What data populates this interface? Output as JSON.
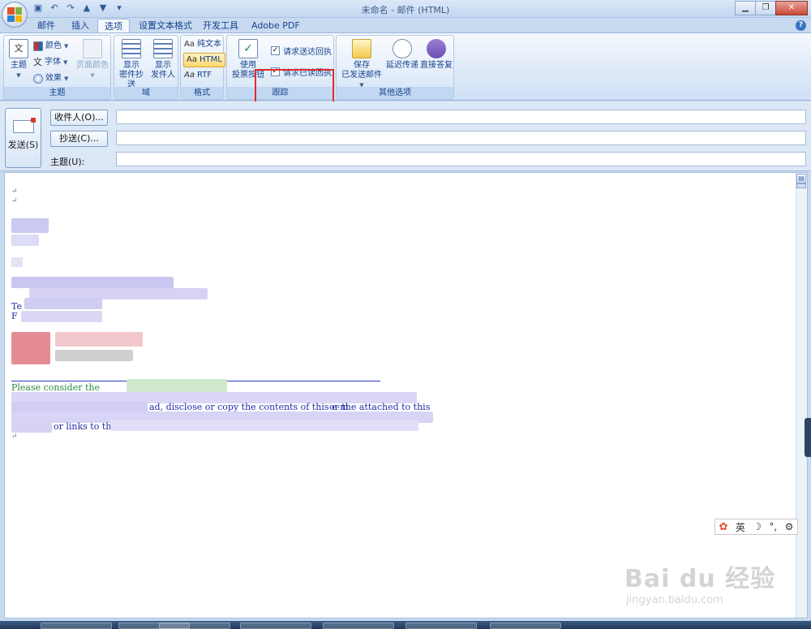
{
  "window": {
    "title": "未命名 - 邮件 (HTML)"
  },
  "tabs": [
    {
      "label": "邮件"
    },
    {
      "label": "插入"
    },
    {
      "label": "选项"
    },
    {
      "label": "设置文本格式"
    },
    {
      "label": "开发工具"
    },
    {
      "label": "Adobe PDF"
    }
  ],
  "ribbon": {
    "theme_group": {
      "label": "主题",
      "theme_btn": "主题",
      "colors": "颜色",
      "fonts": "字体",
      "effects": "效果",
      "page_color": "页面颜色"
    },
    "fields_group": {
      "label": "域",
      "show_bcc_line1": "显示",
      "show_bcc_line2": "密件抄送",
      "show_from_line1": "显示",
      "show_from_line2": "发件人"
    },
    "format_group": {
      "label": "格式",
      "plain": "纯文本",
      "html": "HTML",
      "rtf": "RTF"
    },
    "tracking_group": {
      "label": "跟踪",
      "voting_line1": "使用",
      "voting_line2": "投票按钮",
      "delivery_receipt": "请求送达回执",
      "read_receipt": "请求已读回执"
    },
    "more_group": {
      "label": "其他选项",
      "save_sent_line1": "保存",
      "save_sent_line2": "已发送邮件",
      "delay_delivery": "延迟传递",
      "direct_replies": "直接答复"
    }
  },
  "header": {
    "send": "发送(S)",
    "to_btn": "收件人(O)...",
    "cc_btn": "抄送(C)...",
    "subject_label": "主题(U):",
    "to_value": "",
    "cc_value": "",
    "subject_value": ""
  },
  "body": {
    "lines": {
      "l1": "↵",
      "l2": "↵",
      "tel": "Te",
      "f": "F",
      "please": "Please consider the",
      "p_text": "ad, disclose or copy the contents of this e-m",
      "p_attached": "or the attached to this",
      "links": "or links to this",
      "end": "↵"
    }
  },
  "ime": {
    "lang": "英"
  },
  "watermark": {
    "brand": "Bai du 经验",
    "url": "jingyan.baidu.com"
  }
}
